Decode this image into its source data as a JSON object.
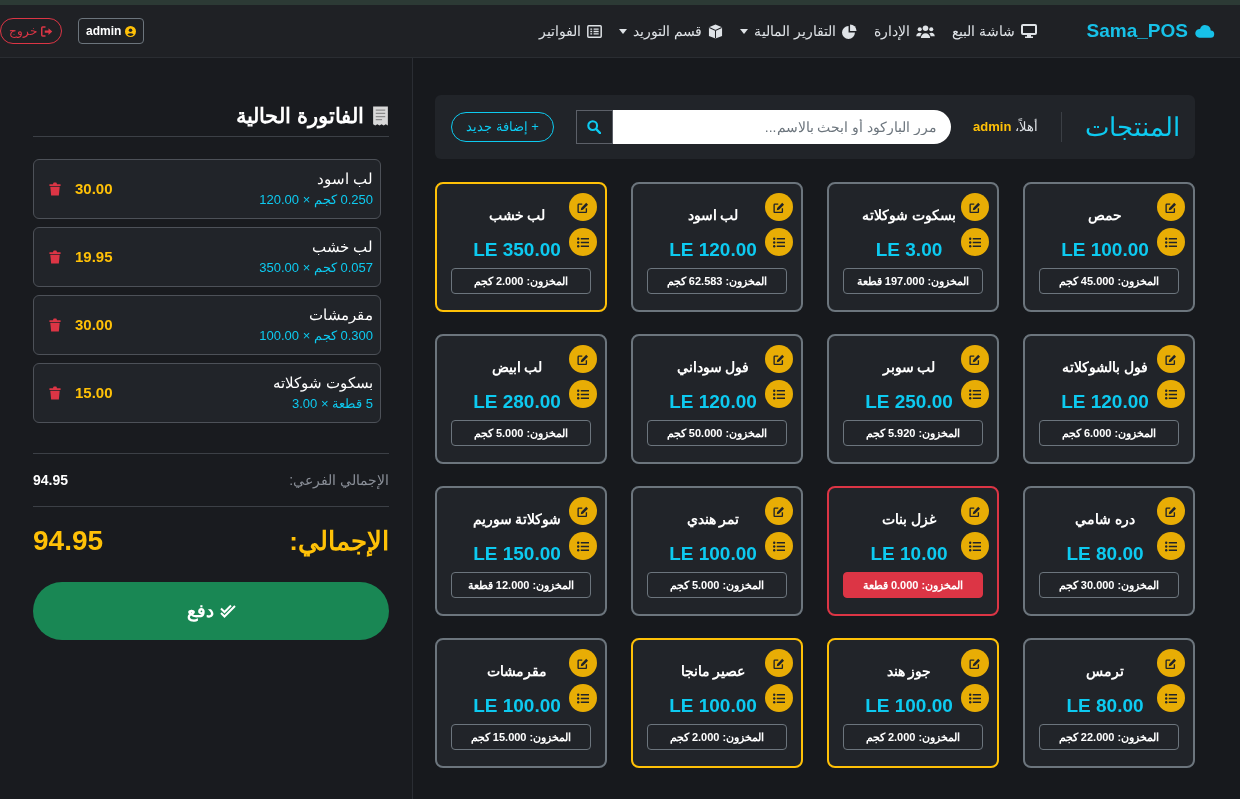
{
  "navbar": {
    "brand": "Sama_POS",
    "links": [
      {
        "label": "شاشة البيع",
        "dropdown": false
      },
      {
        "label": "الإدارة",
        "dropdown": false
      },
      {
        "label": "التقارير المالية",
        "dropdown": true
      },
      {
        "label": "قسم التوريد",
        "dropdown": true
      },
      {
        "label": "الفواتير",
        "dropdown": false
      }
    ],
    "user": "admin",
    "logout": "خروج"
  },
  "products_panel": {
    "title": "المنتجات",
    "greeting": "أهلاً،",
    "user": "admin",
    "search": {
      "placeholder": "مرر الباركود أو ابحث بالاسم..."
    },
    "add_button": "+ إضافة جديد"
  },
  "products": [
    {
      "kind": "normal",
      "name": "حمص",
      "price": "LE 100.00",
      "stock": "المخزون: 45.000 كجم"
    },
    {
      "kind": "normal",
      "name": "بسكوت شوكلاته",
      "price": "LE 3.00",
      "stock": "المخزون: 197.000 قطعة"
    },
    {
      "kind": "normal",
      "name": "لب اسود",
      "price": "LE 120.00",
      "stock": "المخزون: 62.583 كجم"
    },
    {
      "kind": "low",
      "name": "لب خشب",
      "price": "LE 350.00",
      "stock": "المخزون: 2.000 كجم"
    },
    {
      "kind": "normal",
      "name": "فول بالشوكلاته",
      "price": "LE 120.00",
      "stock": "المخزون: 6.000 كجم"
    },
    {
      "kind": "normal",
      "name": "لب سوبر",
      "price": "LE 250.00",
      "stock": "المخزون: 5.920 كجم"
    },
    {
      "kind": "normal",
      "name": "فول سوداني",
      "price": "LE 120.00",
      "stock": "المخزون: 50.000 كجم"
    },
    {
      "kind": "normal",
      "name": "لب ابيض",
      "price": "LE 280.00",
      "stock": "المخزون: 5.000 كجم"
    },
    {
      "kind": "normal",
      "name": "دره شامي",
      "price": "LE 80.00",
      "stock": "المخزون: 30.000 كجم"
    },
    {
      "kind": "out",
      "name": "غزل بنات",
      "price": "LE 10.00",
      "stock": "المخزون: 0.000 قطعة"
    },
    {
      "kind": "normal",
      "name": "تمر هندي",
      "price": "LE 100.00",
      "stock": "المخزون: 5.000 كجم"
    },
    {
      "kind": "normal",
      "name": "شوكلاتة سوريم",
      "price": "LE 150.00",
      "stock": "المخزون: 12.000 قطعة"
    },
    {
      "kind": "normal",
      "name": "ترمس",
      "price": "LE 80.00",
      "stock": "المخزون: 22.000 كجم"
    },
    {
      "kind": "low",
      "name": "جوز هند",
      "price": "LE 100.00",
      "stock": "المخزون: 2.000 كجم"
    },
    {
      "kind": "low",
      "name": "عصير مانجا",
      "price": "LE 100.00",
      "stock": "المخزون: 2.000 كجم"
    },
    {
      "kind": "normal",
      "name": "مقرمشات",
      "price": "LE 100.00",
      "stock": "المخزون: 15.000 كجم"
    }
  ],
  "invoice": {
    "title": "الفاتورة الحالية",
    "items": [
      {
        "name": "لب اسود",
        "quantity": "0.250 كجم × 120.00",
        "total": "30.00"
      },
      {
        "name": "لب خشب",
        "quantity": "0.057 كجم × 350.00",
        "total": "19.95"
      },
      {
        "name": "مقرمشات",
        "quantity": "0.300 كجم × 100.00",
        "total": "30.00"
      },
      {
        "name": "بسكوت شوكلاته",
        "quantity": "5 قطعة × 3.00",
        "total": "15.00"
      }
    ],
    "subtotal_label": "الإجمالي الفرعي:",
    "subtotal": "94.95",
    "total_label": "الإجمالي:",
    "total": "94.95",
    "pay_button": "دفع"
  }
}
